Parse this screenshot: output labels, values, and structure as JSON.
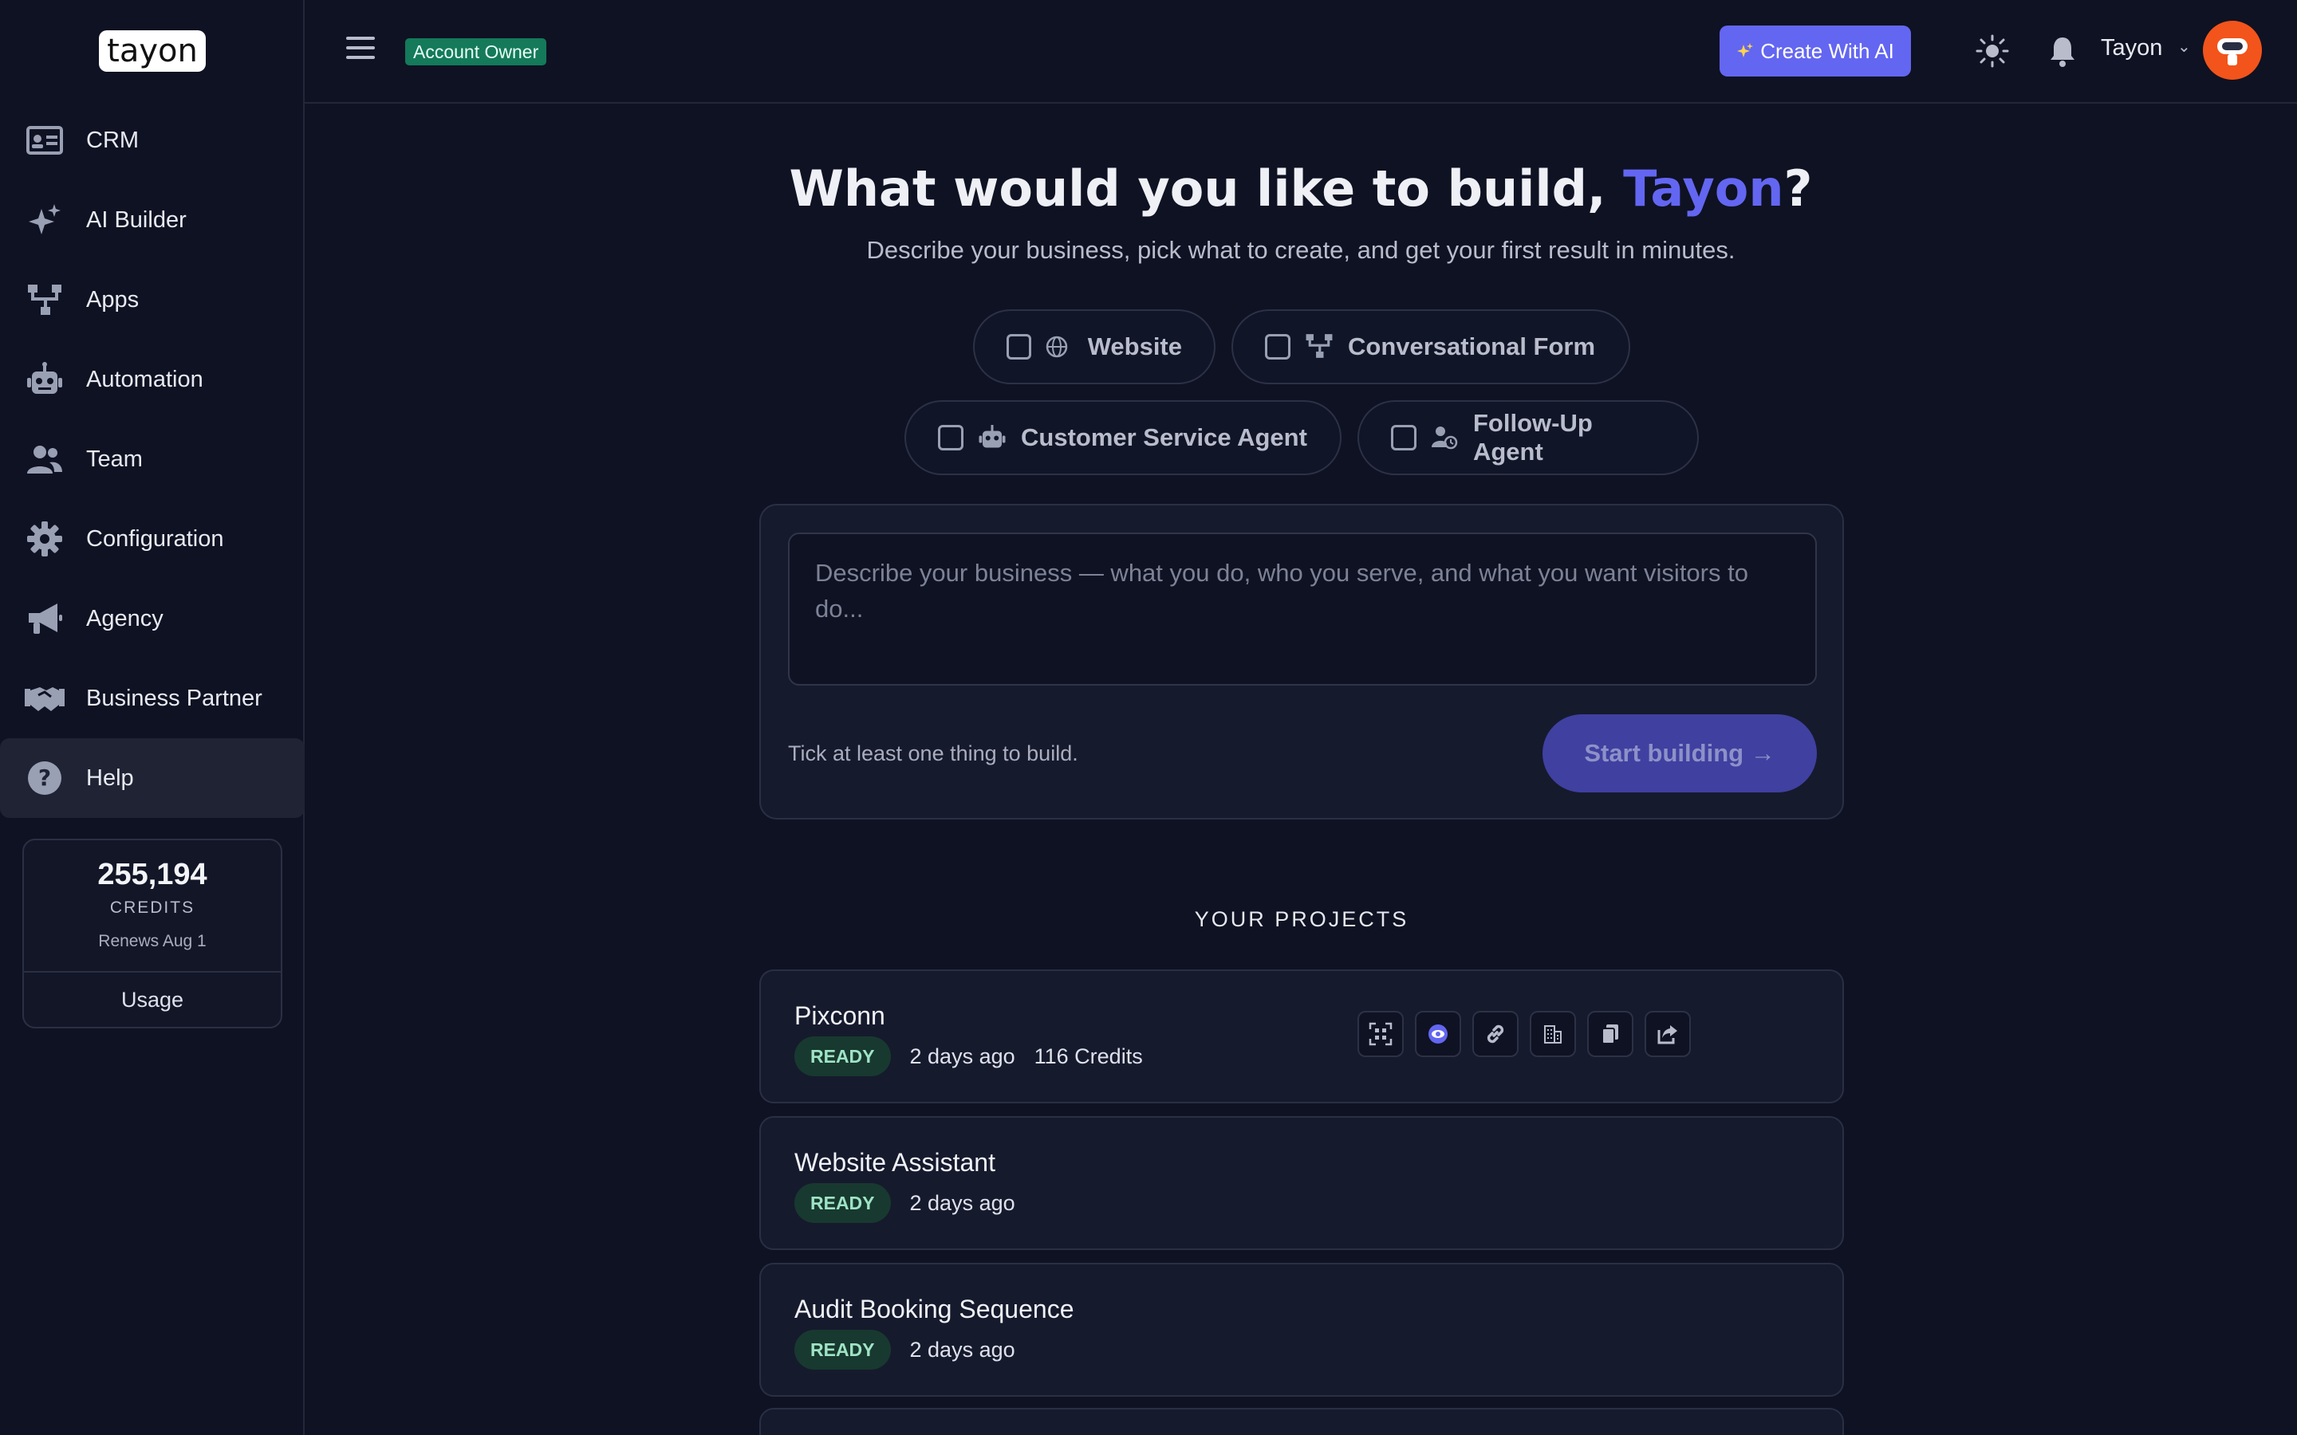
{
  "brand": {
    "logo_text": "tayon"
  },
  "sidebar": {
    "items": [
      {
        "label": "CRM",
        "icon": "id-card-icon"
      },
      {
        "label": "AI Builder",
        "icon": "sparkles-icon"
      },
      {
        "label": "Apps",
        "icon": "sitemap-icon"
      },
      {
        "label": "Automation",
        "icon": "robot-icon"
      },
      {
        "label": "Team",
        "icon": "users-icon"
      },
      {
        "label": "Configuration",
        "icon": "gear-icon"
      },
      {
        "label": "Agency",
        "icon": "megaphone-icon"
      },
      {
        "label": "Business Partner",
        "icon": "handshake-icon"
      },
      {
        "label": "Help",
        "icon": "question-circle-icon",
        "active": true
      }
    ],
    "credits": {
      "amount": "255,194",
      "label": "CREDITS",
      "renews": "Renews Aug 1",
      "usage_label": "Usage"
    }
  },
  "header": {
    "role_badge": "Account Owner",
    "create_button": "Create With AI",
    "user_name": "Tayon",
    "accent_color": "#6366f1"
  },
  "hero": {
    "title_prefix": "What would you like to build, ",
    "title_name": "Tayon",
    "title_suffix": "?",
    "subtitle": "Describe your business, pick what to create, and get your first result in minutes."
  },
  "build_options": [
    {
      "label": "Website",
      "icon": "globe-icon",
      "checked": false
    },
    {
      "label": "Conversational Form",
      "icon": "sitemap-icon",
      "checked": false
    },
    {
      "label": "Customer Service Agent",
      "icon": "robot-icon",
      "checked": false
    },
    {
      "label": "Follow-Up Agent",
      "icon": "user-clock-icon",
      "checked": false
    }
  ],
  "prompt": {
    "placeholder": "Describe your business — what you do, who you serve, and what you want visitors to do...",
    "hint": "Tick at least one thing to build.",
    "start_button": "Start building →"
  },
  "projects": {
    "section_title": "YOUR PROJECTS",
    "items": [
      {
        "name": "Pixconn",
        "status": "READY",
        "updated": "2 days ago",
        "credits": "116 Credits"
      },
      {
        "name": "Website Assistant",
        "status": "READY",
        "updated": "2 days ago"
      },
      {
        "name": "Audit Booking Sequence",
        "status": "READY",
        "updated": "2 days ago"
      }
    ]
  }
}
